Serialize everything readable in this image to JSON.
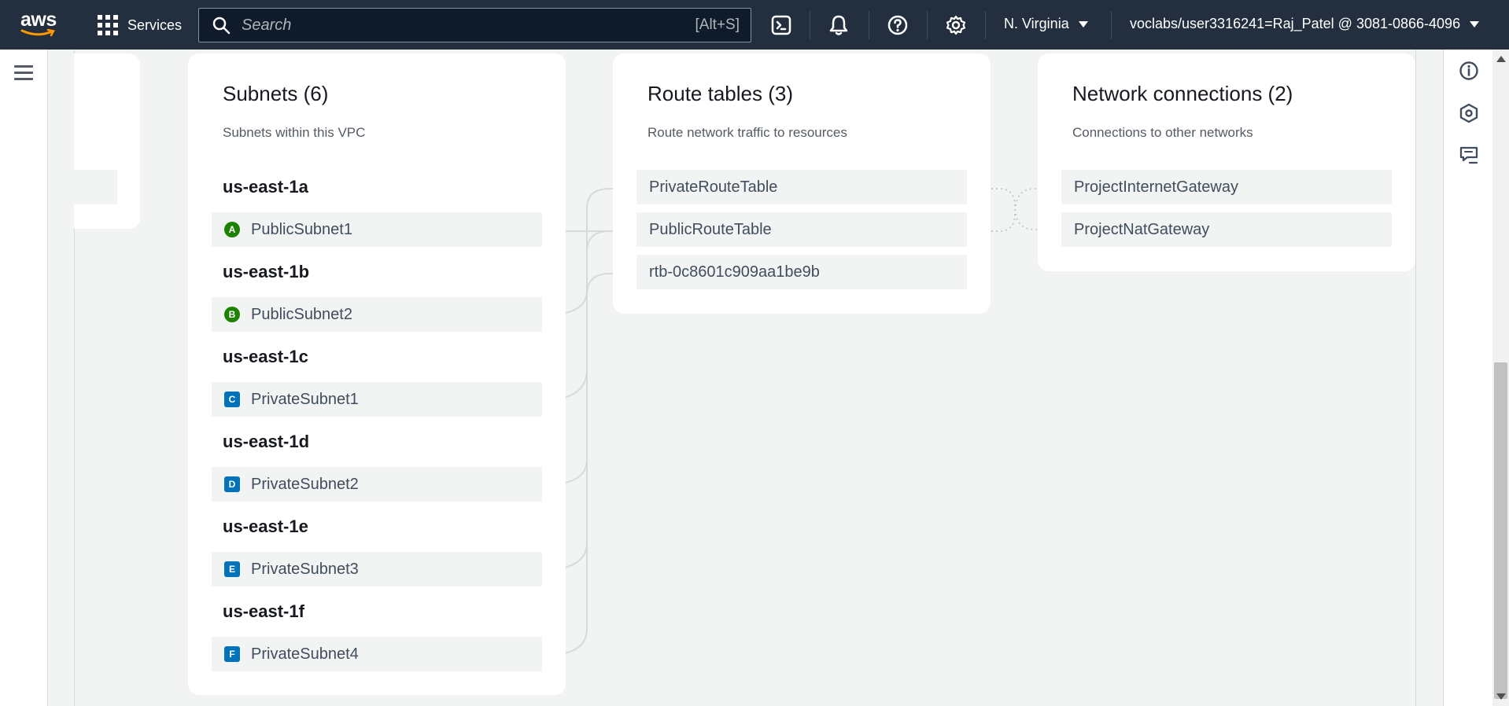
{
  "nav": {
    "logo_text": "aws",
    "services_label": "Services",
    "search_placeholder": "Search",
    "search_shortcut": "[Alt+S]",
    "region": "N. Virginia",
    "account": "voclabs/user3316241=Raj_Patel @ 3081-0866-4096"
  },
  "subnets": {
    "title": "Subnets (6)",
    "subtitle": "Subnets within this VPC",
    "zones": [
      {
        "zone": "us-east-1a",
        "badge": "A",
        "name": "PublicSubnet1",
        "kind": "public"
      },
      {
        "zone": "us-east-1b",
        "badge": "B",
        "name": "PublicSubnet2",
        "kind": "public"
      },
      {
        "zone": "us-east-1c",
        "badge": "C",
        "name": "PrivateSubnet1",
        "kind": "private"
      },
      {
        "zone": "us-east-1d",
        "badge": "D",
        "name": "PrivateSubnet2",
        "kind": "private"
      },
      {
        "zone": "us-east-1e",
        "badge": "E",
        "name": "PrivateSubnet3",
        "kind": "private"
      },
      {
        "zone": "us-east-1f",
        "badge": "F",
        "name": "PrivateSubnet4",
        "kind": "private"
      }
    ]
  },
  "route_tables": {
    "title": "Route tables (3)",
    "subtitle": "Route network traffic to resources",
    "items": [
      "PrivateRouteTable",
      "PublicRouteTable",
      "rtb-0c8601c909aa1be9b"
    ]
  },
  "network_connections": {
    "title": "Network connections (2)",
    "subtitle": "Connections to other networks",
    "items": [
      "ProjectInternetGateway",
      "ProjectNatGateway"
    ]
  },
  "colors": {
    "nav_bg": "#232f3e",
    "public_badge": "#1d8102",
    "private_badge": "#0073bb",
    "link_line": "#d5dbdb"
  }
}
